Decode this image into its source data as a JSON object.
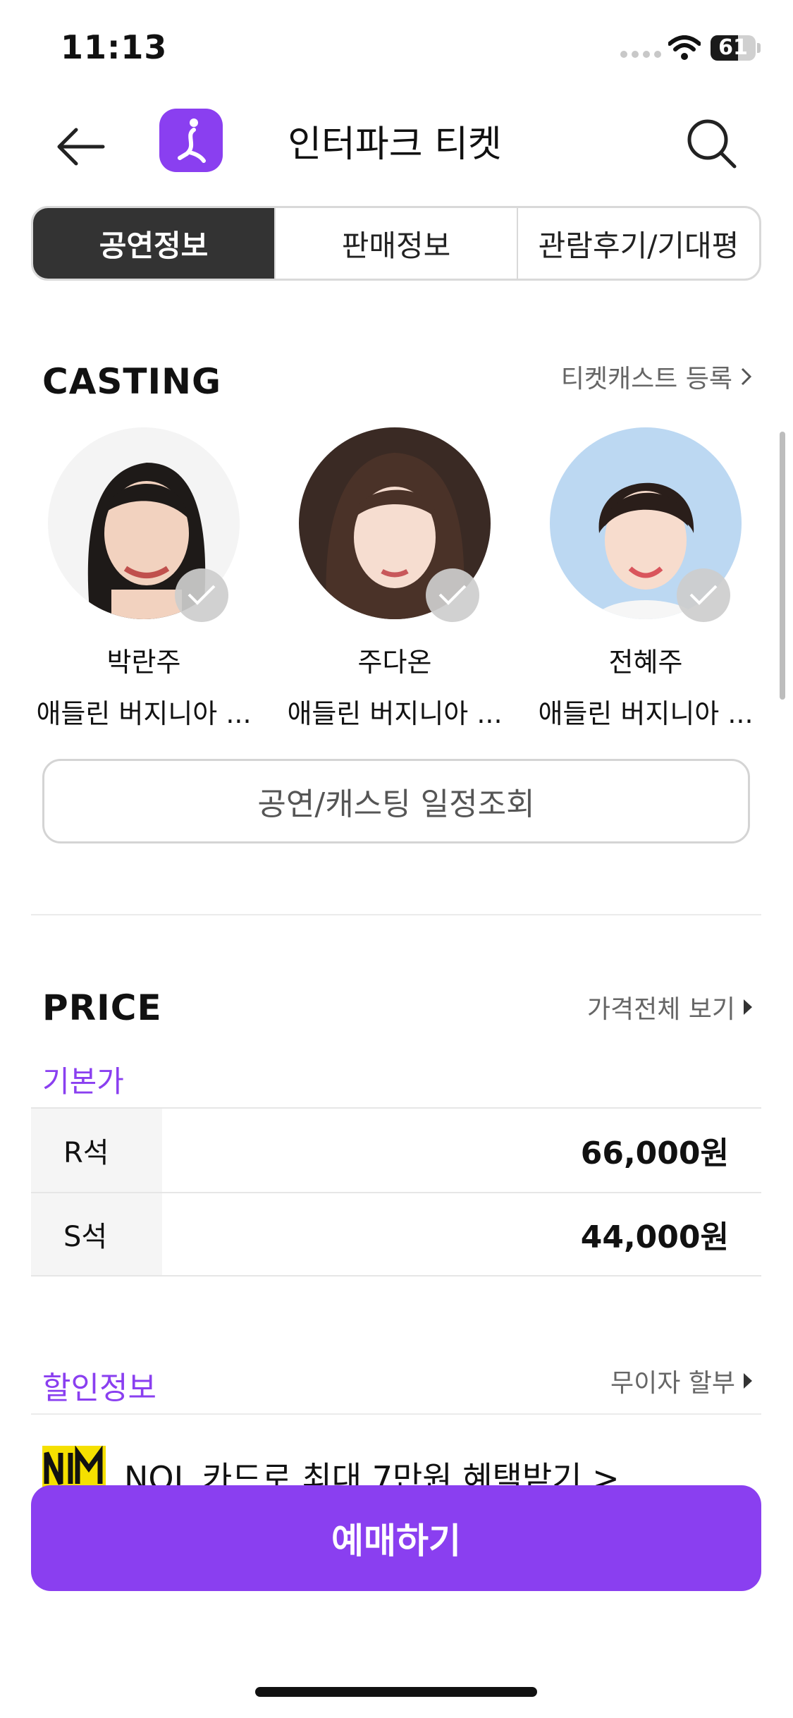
{
  "status_bar": {
    "time": "11:13",
    "battery_level": "61",
    "battery_fraction": 0.61
  },
  "header": {
    "title": "인터파크 티켓",
    "back_icon": "arrow-left-icon",
    "logo_icon": "interpark-logo-icon",
    "search_icon": "search-icon"
  },
  "tabs": [
    {
      "label": "공연정보",
      "active": true
    },
    {
      "label": "판매정보",
      "active": false
    },
    {
      "label": "관람후기/기대평",
      "active": false
    }
  ],
  "casting": {
    "title": "CASTING",
    "link": "티켓캐스트 등록",
    "members": [
      {
        "name": "박란주",
        "role": "애들린 버지니아 ..."
      },
      {
        "name": "주다온",
        "role": "애들린 버지니아 ..."
      },
      {
        "name": "전혜주",
        "role": "애들린 버지니아 ..."
      }
    ],
    "schedule_button": "공연/캐스팅 일정조회"
  },
  "price": {
    "title": "PRICE",
    "link": "가격전체 보기",
    "subtitle": "기본가",
    "rows": [
      {
        "grade": "R석",
        "value": "66,000원"
      },
      {
        "grade": "S석",
        "value": "44,000원"
      }
    ]
  },
  "discount": {
    "title": "할인정보",
    "link": "무이자 할부",
    "item": "NOL 카드로 최대 7만원 혜택받기 >"
  },
  "cta": {
    "label": "예매하기"
  },
  "colors": {
    "accent": "#8a3ff0",
    "tab_active": "#333333"
  }
}
